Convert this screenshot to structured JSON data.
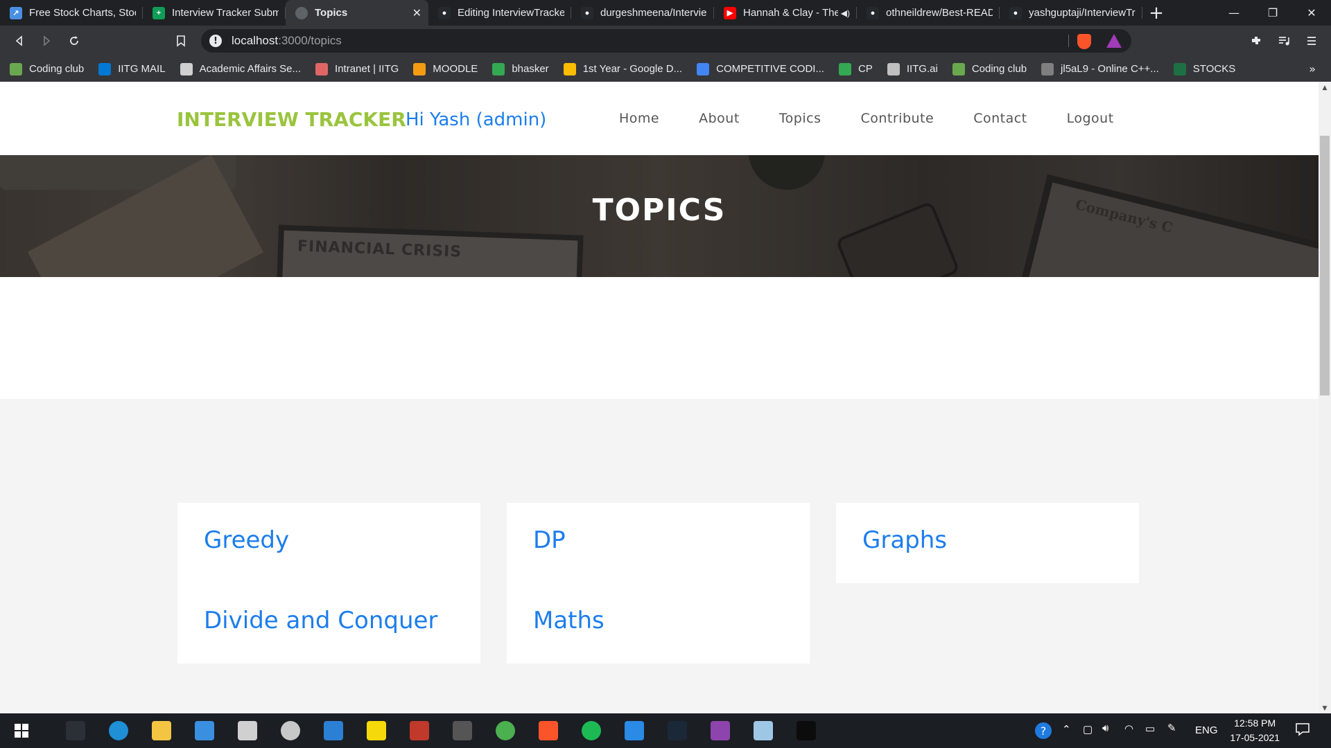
{
  "browser": {
    "tabs": [
      {
        "title": "Free Stock Charts, Stock",
        "color": "#4a90e2",
        "glyph": "↗"
      },
      {
        "title": "Interview Tracker Subm",
        "color": "#0f9d58",
        "glyph": "+"
      },
      {
        "title": "Topics",
        "color": "#5f6368",
        "glyph": "",
        "active": true
      },
      {
        "title": "Editing InterviewTracker",
        "color": "#24292e",
        "glyph": "●"
      },
      {
        "title": "durgeshmeena/Intervie",
        "color": "#24292e",
        "glyph": "●"
      },
      {
        "title": "Hannah & Clay - The",
        "color": "#ff0000",
        "glyph": "▶",
        "audio": true
      },
      {
        "title": "othneildrew/Best-READ",
        "color": "#24292e",
        "glyph": "●"
      },
      {
        "title": "yashguptaji/InterviewTra",
        "color": "#24292e",
        "glyph": "●"
      }
    ],
    "tab_close_glyph": "✕",
    "new_tab_glyph": "+",
    "window_controls": {
      "minimize": "—",
      "restore": "❐",
      "close": "✕"
    },
    "url_host": "localhost",
    "url_path": ":3000/topics",
    "info_glyph": "!",
    "bookmarks": [
      {
        "label": "Coding club",
        "color": "#6aa84f"
      },
      {
        "label": "IITG MAIL",
        "color": "#0078d4"
      },
      {
        "label": "Academic Affairs Se...",
        "color": "#d0d0d0"
      },
      {
        "label": "Intranet | IITG",
        "color": "#e06666"
      },
      {
        "label": "MOODLE",
        "color": "#f39c12"
      },
      {
        "label": "bhasker",
        "color": "#34a853"
      },
      {
        "label": "1st Year - Google D...",
        "color": "#fbbc04"
      },
      {
        "label": "COMPETITIVE CODI...",
        "color": "#4285f4"
      },
      {
        "label": "CP",
        "color": "#34a853"
      },
      {
        "label": "IITG.ai",
        "color": "#c0c0c0"
      },
      {
        "label": "Coding club",
        "color": "#6aa84f"
      },
      {
        "label": "jl5aL9 - Online C++...",
        "color": "#7f7f7f"
      },
      {
        "label": "STOCKS",
        "color": "#1d7044"
      }
    ],
    "bookmarks_more": "»"
  },
  "site": {
    "brand": "INTERVIEW TRACKER",
    "greeting": "Hi Yash (admin)",
    "menu": [
      "Home",
      "About",
      "Topics",
      "Contribute",
      "Contact",
      "Logout"
    ],
    "hero_title": "TOPICS",
    "hero_paper_text": "FINANCIAL CRISIS",
    "hero_tablet_text": "Company's C",
    "topics": [
      "Greedy",
      "DP",
      "Graphs",
      "Divide and Conquer",
      "Maths"
    ]
  },
  "taskbar": {
    "tray_lang": "ENG",
    "clock_time": "12:58 PM",
    "clock_date": "17-05-2021",
    "apps": [
      {
        "name": "settings",
        "color": "#2b2f36"
      },
      {
        "name": "edge",
        "color": "#1f8fd6"
      },
      {
        "name": "file-explorer",
        "color": "#f4c542"
      },
      {
        "name": "mail",
        "color": "#3b8fe0"
      },
      {
        "name": "store",
        "color": "#d0d0d0"
      },
      {
        "name": "clock",
        "color": "#c8c8c8"
      },
      {
        "name": "vs-blue",
        "color": "#2b7fd4"
      },
      {
        "name": "sticky-notes",
        "color": "#f5d90a"
      },
      {
        "name": "red-app",
        "color": "#c0392b"
      },
      {
        "name": "game-app",
        "color": "#555555"
      },
      {
        "name": "chrome",
        "color": "#4caf50"
      },
      {
        "name": "brave",
        "color": "#fb542b"
      },
      {
        "name": "spotify",
        "color": "#1db954"
      },
      {
        "name": "vscode",
        "color": "#2a8ae6"
      },
      {
        "name": "steam",
        "color": "#1b2838"
      },
      {
        "name": "winrar",
        "color": "#8e44ad"
      },
      {
        "name": "notes-app",
        "color": "#9ec7e5"
      },
      {
        "name": "terminal",
        "color": "#0c0c0c"
      }
    ]
  }
}
